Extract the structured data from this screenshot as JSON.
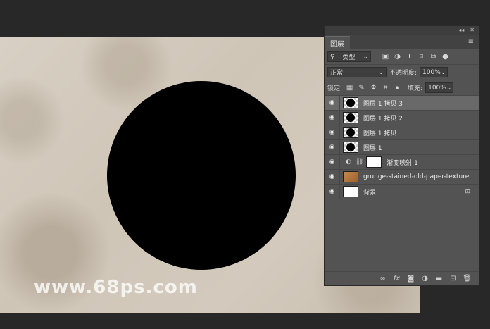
{
  "watermark": "www.68ps.com",
  "panel": {
    "tab": "图层",
    "topbar_collapse": "◂◂",
    "topbar_close": "✕",
    "menu_icon": "hamburger-icon",
    "filter_dropdown": "类型",
    "blend_mode": "正常",
    "opacity_label": "不透明度:",
    "opacity_value": "100%",
    "lock_label": "锁定:",
    "fill_label": "填充:",
    "fill_value": "100%"
  },
  "layers": [
    {
      "name": "图层 1 拷贝 3",
      "thumb": "circle",
      "selected": true
    },
    {
      "name": "图层 1 拷贝 2",
      "thumb": "circle",
      "selected": false
    },
    {
      "name": "图层 1 拷贝",
      "thumb": "circle",
      "selected": false
    },
    {
      "name": "图层 1",
      "thumb": "circle",
      "selected": false
    },
    {
      "name": "渐变映射 1",
      "thumb": "adjustment",
      "selected": false
    },
    {
      "name": "grunge-stained-old-paper-texture",
      "thumb": "paper",
      "selected": false
    },
    {
      "name": "背景",
      "thumb": "white",
      "selected": false,
      "locked": true
    }
  ],
  "colors": {
    "app_bg": "#282828",
    "panel_bg": "#535353",
    "selected_layer": "#696969",
    "paper": "#d3cabd",
    "circle": "#000000"
  }
}
